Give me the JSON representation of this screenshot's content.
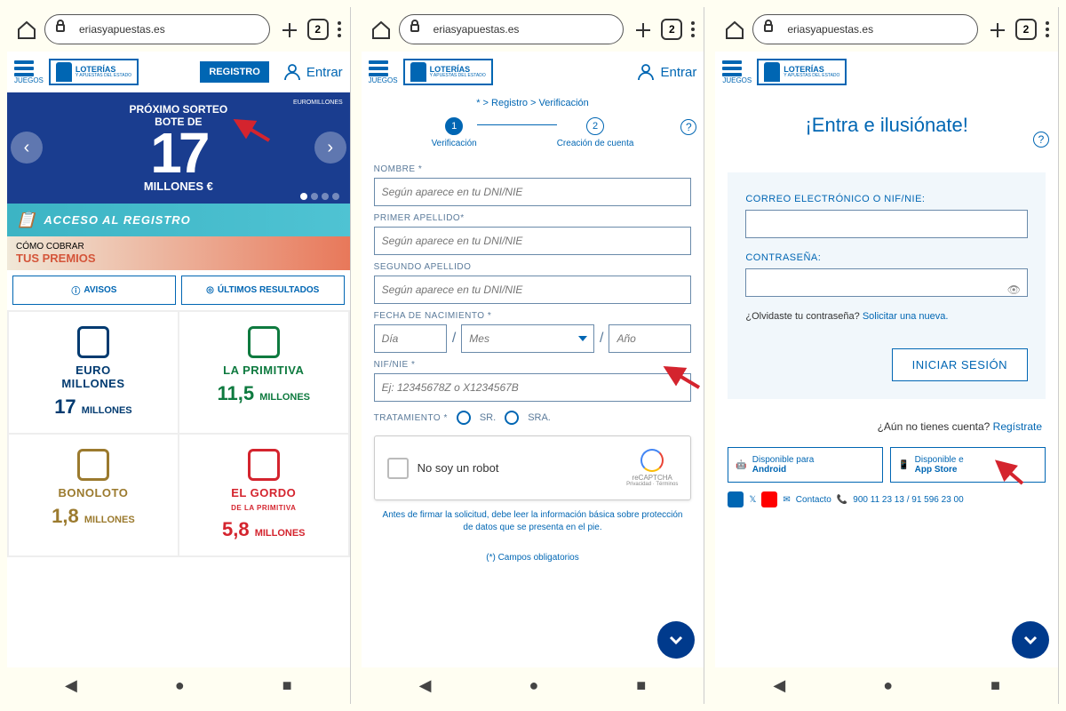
{
  "browser": {
    "url": "eriasyapuestas.es",
    "tab_count": "2"
  },
  "header": {
    "juegos": "JUEGOS",
    "logo_main": "LOTERÍAS",
    "logo_sub": "Y APUESTAS DEL ESTADO",
    "registro": "REGISTRO",
    "entrar": "Entrar"
  },
  "screen1": {
    "hero_subtitle": "PRÓXIMO SORTEO",
    "hero_bote": "BOTE DE",
    "hero_number": "17",
    "hero_millones": "MILLONES €",
    "euromil_badge": "EUROMILLONES",
    "banner1": "ACCESO AL REGISTRO",
    "banner2_top": "CÓMO COBRAR",
    "banner2_bottom": "TUS PREMIOS",
    "avisos": "AVISOS",
    "ultimos": "ÚLTIMOS RESULTADOS",
    "games": [
      {
        "name_l1": "EURO",
        "name_l2": "MILLONES",
        "amount": "17",
        "unit": "MILLONES"
      },
      {
        "name_l1": "",
        "name_l2": "LA PRIMITIVA",
        "amount": "11,5",
        "unit": "MILLONES"
      },
      {
        "name_l1": "",
        "name_l2": "BONOLOTO",
        "amount": "1,8",
        "unit": "MILLONES"
      },
      {
        "name_l1": "EL GORDO",
        "name_l2": "DE LA PRIMITIVA",
        "amount": "5,8",
        "unit": "MILLONES"
      }
    ]
  },
  "screen2": {
    "breadcrumb": "* > Registro > Verificación",
    "step1": "Verificación",
    "step2": "Creación de cuenta",
    "nombre_label": "NOMBRE *",
    "primer_label": "PRIMER APELLIDO*",
    "segundo_label": "SEGUNDO APELLIDO",
    "dni_placeholder": "Según aparece en tu DNI/NIE",
    "fecha_label": "FECHA DE NACIMIENTO *",
    "dia": "Día",
    "mes": "Mes",
    "ano": "Año",
    "nif_label": "NIF/NIE *",
    "nif_placeholder": "Ej: 12345678Z o X1234567B",
    "trat_label": "TRATAMIENTO *",
    "sr": "SR.",
    "sra": "SRA.",
    "captcha": "No soy un robot",
    "captcha_brand": "reCAPTCHA",
    "captcha_terms": "Privacidad · Términos",
    "footer1": "Antes de firmar la solicitud, debe leer la información básica sobre protección de datos que se presenta en el pie.",
    "footer2": "(*) Campos obligatorios"
  },
  "screen3": {
    "title": "¡Entra e ilusiónate!",
    "email_label": "CORREO ELECTRÓNICO O NIF/NIE:",
    "pass_label": "CONTRASEÑA:",
    "forgot_q": "¿Olvidaste tu contraseña? ",
    "forgot_link": "Solicitar una nueva.",
    "login_btn": "INICIAR SESIÓN",
    "no_account_q": "¿Aún no tienes cuenta? ",
    "no_account_link": "Regístrate",
    "android_top": "Disponible para",
    "android": "Android",
    "appstore_top": "Disponible e",
    "appstore": "App Store",
    "contacto": "Contacto",
    "phones": "900 11 23 13 / 91 596 23 00"
  }
}
